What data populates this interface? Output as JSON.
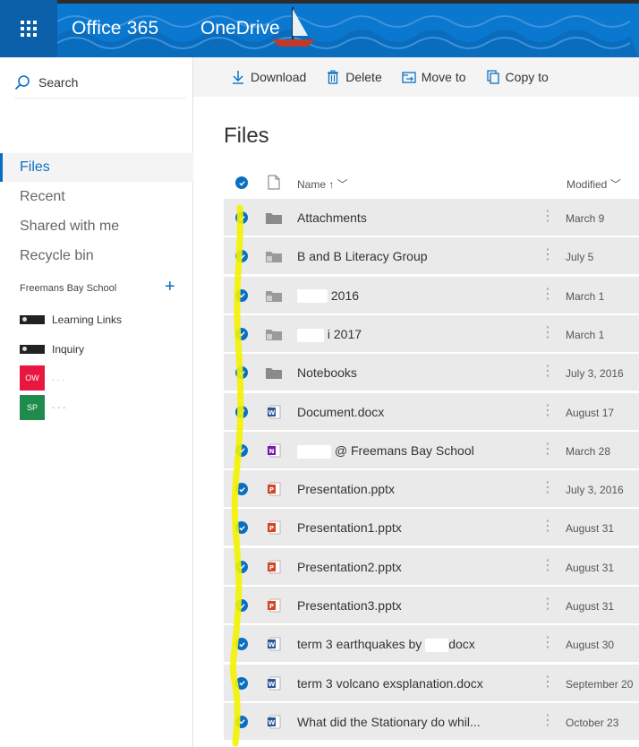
{
  "header": {
    "brand": "Office 365",
    "app": "OneDrive",
    "bg_color": "#0b78d0"
  },
  "search": {
    "label": "Search"
  },
  "nav": {
    "items": [
      {
        "label": "Files",
        "active": true
      },
      {
        "label": "Recent"
      },
      {
        "label": "Shared with me"
      },
      {
        "label": "Recycle bin"
      }
    ],
    "group": {
      "label": "Freemans Bay School",
      "items": [
        {
          "label": "Learning Links",
          "type": "thumb"
        },
        {
          "label": "Inquiry",
          "type": "thumb"
        },
        {
          "label": "",
          "tile": "OW",
          "color": "#e8173f",
          "sub": ". . ."
        },
        {
          "label": "",
          "tile": "SP",
          "color": "#1f8b4c",
          "sub": "- - -"
        }
      ]
    }
  },
  "toolbar": {
    "download": "Download",
    "delete": "Delete",
    "move": "Move to",
    "copy": "Copy to"
  },
  "page": {
    "title": "Files"
  },
  "list": {
    "col_name": "Name ↑ ﹀",
    "col_modified": "Modified ﹀",
    "rows": [
      {
        "name": "Attachments",
        "type": "folder",
        "modified": "March 9"
      },
      {
        "name": "B and B Literacy Group",
        "type": "folder-shared",
        "modified": "July 5"
      },
      {
        "name": "2016",
        "type": "folder-shared",
        "modified": "March 1",
        "redact": 34
      },
      {
        "name": "i 2017",
        "type": "folder-shared",
        "modified": "March 1",
        "redact": 30
      },
      {
        "name": "Notebooks",
        "type": "folder",
        "modified": "July 3, 2016"
      },
      {
        "name": "Document.docx",
        "type": "word",
        "modified": "August 17"
      },
      {
        "name": "@ Freemans Bay School",
        "type": "onenote",
        "modified": "March 28",
        "redact": 38
      },
      {
        "name": "Presentation.pptx",
        "type": "ppt",
        "modified": "July 3, 2016"
      },
      {
        "name": "Presentation1.pptx",
        "type": "ppt",
        "modified": "August 31"
      },
      {
        "name": "Presentation2.pptx",
        "type": "ppt",
        "modified": "August 31"
      },
      {
        "name": "Presentation3.pptx",
        "type": "ppt",
        "modified": "August 31"
      },
      {
        "name": "term 3 earthquakes by",
        "name2": "docx",
        "type": "word",
        "modified": "August 30",
        "redact_mid": 26
      },
      {
        "name": "term 3 volcano exsplanation.docx",
        "type": "word",
        "modified": "September 20"
      },
      {
        "name": "What did the Stationary do whil...",
        "type": "word",
        "modified": "October 23"
      }
    ]
  },
  "colors": {
    "accent": "#0a6fc2",
    "highlighter": "#f3f300"
  }
}
